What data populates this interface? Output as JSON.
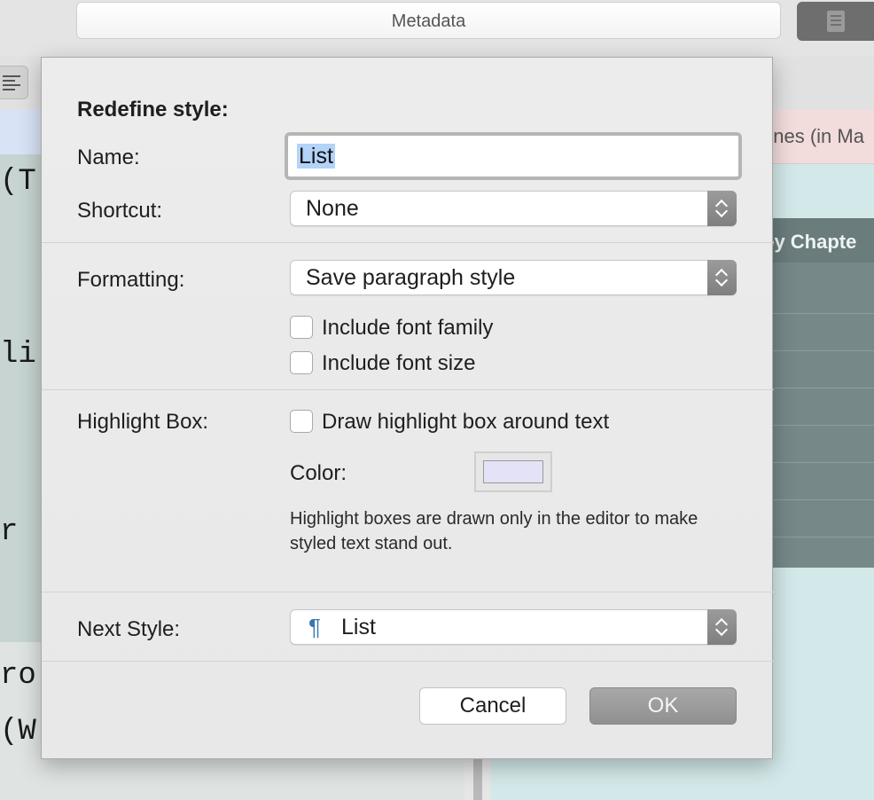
{
  "background": {
    "metadata_label": "Metadata",
    "code_fragments": [
      "(T",
      "li",
      "r",
      "ro",
      "(W"
    ],
    "right_pane_header": "enes (in Ma",
    "right_table_header": "by Chapte"
  },
  "dialog": {
    "title": "Redefine style:",
    "name_label": "Name:",
    "name_value": "List",
    "shortcut_label": "Shortcut:",
    "shortcut_value": "None",
    "formatting_label": "Formatting:",
    "formatting_value": "Save paragraph style",
    "include_font_family": "Include font family",
    "include_font_size": "Include font size",
    "highlight_box_label": "Highlight Box:",
    "draw_highlight_box": "Draw highlight box around text",
    "color_label": "Color:",
    "highlight_color": "#e3e2f7",
    "help_text": "Highlight boxes are drawn only in the editor to make styled text stand out.",
    "next_style_label": "Next Style:",
    "next_style_value": "List",
    "next_style_icon": "pilcrow-icon",
    "cancel_label": "Cancel",
    "ok_label": "OK"
  }
}
